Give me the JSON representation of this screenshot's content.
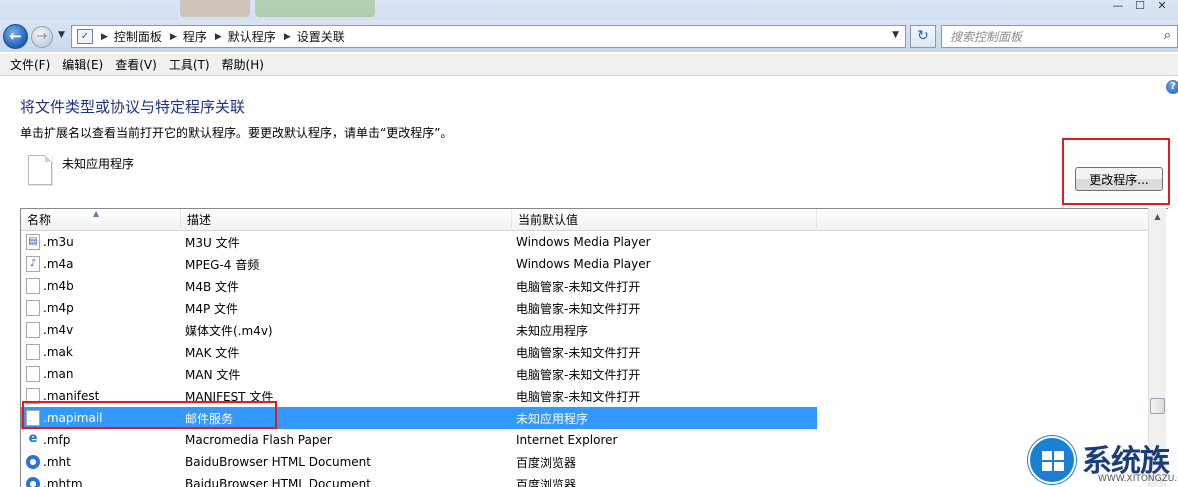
{
  "window": {
    "controls": [
      "—",
      "☐",
      "✕"
    ]
  },
  "address": {
    "crumbs": [
      "控制面板",
      "程序",
      "默认程序",
      "设置关联"
    ],
    "search_placeholder": "搜索控制面板"
  },
  "menu": [
    "文件(F)",
    "编辑(E)",
    "查看(V)",
    "工具(T)",
    "帮助(H)"
  ],
  "page": {
    "title": "将文件类型或协议与特定程序关联",
    "description": "单击扩展名以查看当前打开它的默认程序。要更改默认程序，请单击“更改程序”。",
    "current_app": "未知应用程序",
    "change_button": "更改程序..."
  },
  "list": {
    "columns": [
      "名称",
      "描述",
      "当前默认值"
    ],
    "rows": [
      {
        "name": ".m3u",
        "desc": "M3U 文件",
        "default": "Windows Media Player",
        "icon": "media-file-icon"
      },
      {
        "name": ".m4a",
        "desc": "MPEG-4 音频",
        "default": "Windows Media Player",
        "icon": "audio-file-icon"
      },
      {
        "name": ".m4b",
        "desc": "M4B 文件",
        "default": "电脑管家-未知文件打开",
        "icon": "generic-file-icon"
      },
      {
        "name": ".m4p",
        "desc": "M4P 文件",
        "default": "电脑管家-未知文件打开",
        "icon": "generic-file-icon"
      },
      {
        "name": ".m4v",
        "desc": "媒体文件(.m4v)",
        "default": "未知应用程序",
        "icon": "generic-file-icon"
      },
      {
        "name": ".mak",
        "desc": "MAK 文件",
        "default": "电脑管家-未知文件打开",
        "icon": "generic-file-icon"
      },
      {
        "name": ".man",
        "desc": "MAN 文件",
        "default": "电脑管家-未知文件打开",
        "icon": "generic-file-icon"
      },
      {
        "name": ".manifest",
        "desc": "MANIFEST 文件",
        "default": "电脑管家-未知文件打开",
        "icon": "generic-file-icon"
      },
      {
        "name": ".mapimail",
        "desc": "邮件服务",
        "default": "未知应用程序",
        "icon": "generic-file-icon",
        "selected": true
      },
      {
        "name": ".mfp",
        "desc": "Macromedia Flash Paper",
        "default": "Internet Explorer",
        "icon": "ie-icon"
      },
      {
        "name": ".mht",
        "desc": "BaiduBrowser HTML Document",
        "default": "百度浏览器",
        "icon": "baidu-browser-icon"
      },
      {
        "name": ".mhtm",
        "desc": "BaiduBrowser HTML Document",
        "default": "百度浏览器",
        "icon": "baidu-browser-icon"
      }
    ]
  },
  "watermark": {
    "name": "系统族",
    "url": "WWW.XITONGZU.COM"
  },
  "colors": {
    "selection": "#3399ff",
    "highlight_box": "#e21b1b",
    "title": "#1e3287"
  }
}
